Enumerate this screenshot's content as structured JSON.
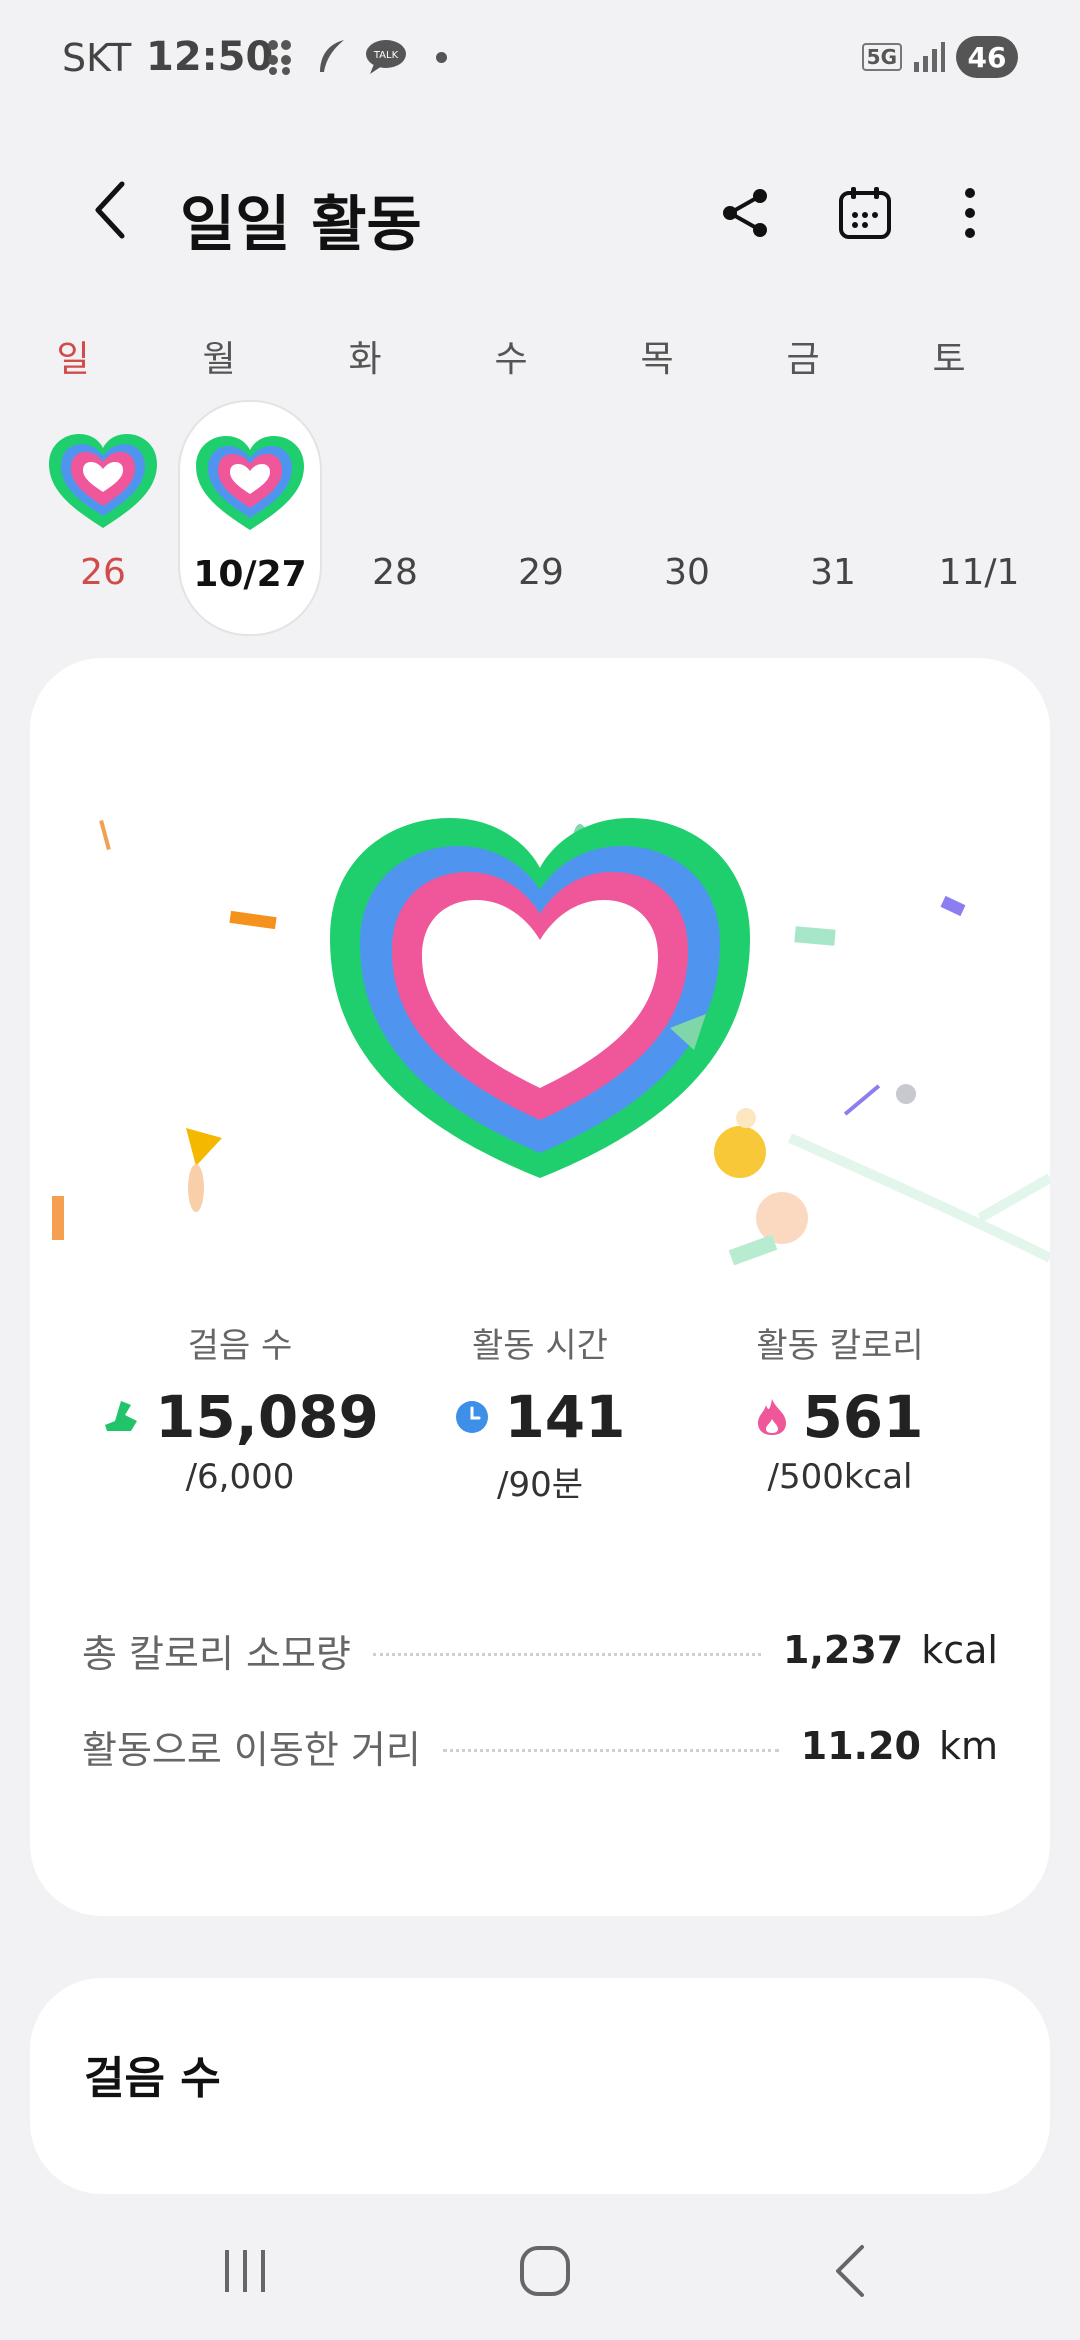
{
  "status_bar": {
    "carrier": "SKT",
    "time": "12:50",
    "network": "5G",
    "battery": "46"
  },
  "header": {
    "title": "일일 활동",
    "icons": [
      "back-icon",
      "share-icon",
      "calendar-icon",
      "more-icon"
    ]
  },
  "week": {
    "weekdays": [
      "일",
      "월",
      "화",
      "수",
      "목",
      "금",
      "토"
    ],
    "dates": [
      "26",
      "10/27",
      "28",
      "29",
      "30",
      "31",
      "11/1"
    ],
    "has_activity": [
      true,
      true,
      false,
      false,
      false,
      false,
      false
    ],
    "selected_index": 1
  },
  "stats": [
    {
      "label": "걸음 수",
      "value": "15,089",
      "goal": "/6,000",
      "icon": "shoe-icon",
      "color": "#22c46a"
    },
    {
      "label": "활동 시간",
      "value": "141",
      "goal": "/90분",
      "icon": "clock-icon",
      "color": "#3d8fe8"
    },
    {
      "label": "활동 칼로리",
      "value": "561",
      "goal": "/500kcal",
      "icon": "flame-icon",
      "color": "#f0569a"
    }
  ],
  "summary": [
    {
      "label": "총 칼로리 소모량",
      "value": "1,237",
      "unit": "kcal"
    },
    {
      "label": "활동으로 이동한 거리",
      "value": "11.20",
      "unit": "km"
    }
  ],
  "steps_card": {
    "title": "걸음 수"
  },
  "colors": {
    "ring_green": "#1fcf6e",
    "ring_blue": "#4f95f0",
    "ring_pink": "#f0569a",
    "sunday_red": "#d24b4b"
  }
}
